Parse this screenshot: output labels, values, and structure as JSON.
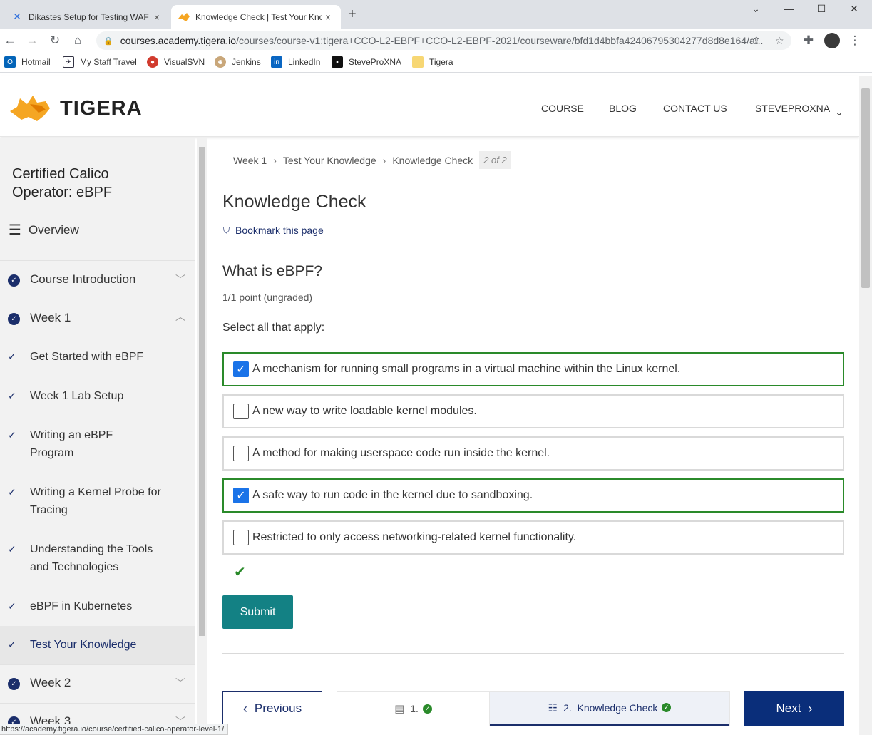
{
  "browser": {
    "tabs": [
      {
        "title": "Dikastes Setup for Testing WAF in",
        "icon": "confluence-icon",
        "active": false
      },
      {
        "title": "Knowledge Check | Test Your Kno",
        "icon": "tigera-icon",
        "active": true
      }
    ],
    "url_host": "courses.academy.tigera.io",
    "url_path": "/courses/course-v1:tigera+CCO-L2-EBPF+CCO-L2-EBPF-2021/courseware/bfd1d4bbfa42406795304277d8d8e164/a...",
    "bookmarks": [
      "Hotmail",
      "My Staff Travel",
      "VisualSVN",
      "Jenkins",
      "LinkedIn",
      "SteveProXNA",
      "Tigera"
    ],
    "status_url": "https://academy.tigera.io/course/certified-calico-operator-level-1/"
  },
  "header": {
    "logo_text": "TIGERA",
    "nav": [
      "COURSE",
      "BLOG",
      "CONTACT US",
      "STEVEPROXNA"
    ]
  },
  "sidebar": {
    "course_title": "Certified Calico Operator: eBPF",
    "overview": "Overview",
    "sections": [
      {
        "label": "Course Introduction",
        "expanded": false
      },
      {
        "label": "Week 1",
        "expanded": true
      },
      {
        "label": "Week 2",
        "expanded": false
      },
      {
        "label": "Week 3",
        "expanded": false
      }
    ],
    "week1_items": [
      "Get Started with eBPF",
      "Week 1 Lab Setup",
      "Writing an eBPF Program",
      "Writing a Kernel Probe for Tracing",
      "Understanding the Tools and Technologies",
      "eBPF in Kubernetes",
      "Test Your Knowledge"
    ],
    "active_item": "Test Your Knowledge"
  },
  "breadcrumb": {
    "items": [
      "Week 1",
      "Test Your Knowledge",
      "Knowledge Check"
    ],
    "position": "2 of 2"
  },
  "main": {
    "page_title": "Knowledge Check",
    "bookmark_label": "Bookmark this page",
    "question": "What is eBPF?",
    "points": "1/1 point (ungraded)",
    "instruction": "Select all that apply:",
    "options": [
      {
        "label": "A mechanism for running small programs in a virtual machine within the Linux kernel.",
        "checked": true
      },
      {
        "label": "A new way to write loadable kernel modules.",
        "checked": false
      },
      {
        "label": "A method for making userspace code run inside the kernel.",
        "checked": false
      },
      {
        "label": "A safe way to run code in the kernel due to sandboxing.",
        "checked": true
      },
      {
        "label": "Restricted to only access networking-related kernel functionality.",
        "checked": false
      }
    ],
    "submit_label": "Submit"
  },
  "sequence_nav": {
    "previous_label": "Previous",
    "next_label": "Next",
    "items": [
      {
        "label": "1.",
        "icon": "document-icon",
        "complete": true
      },
      {
        "label": "2.  Knowledge Check",
        "icon": "list-icon",
        "complete": true,
        "active": true
      }
    ]
  },
  "colors": {
    "brand_navy": "#1b2e6b",
    "submit_teal": "#138184",
    "correct_green": "#2a8a2a",
    "checkbox_blue": "#1a73e8",
    "logo_orange": "#f5a623"
  }
}
